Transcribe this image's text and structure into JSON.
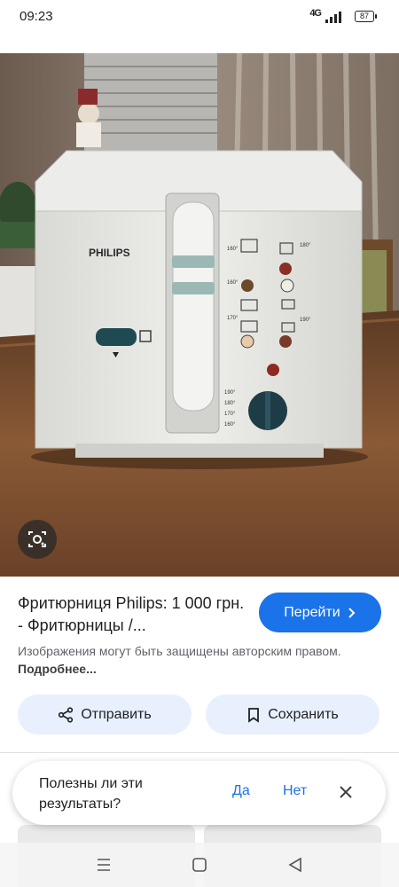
{
  "status": {
    "time": "09:23",
    "network": "4G",
    "battery": "87"
  },
  "result": {
    "title": "Фритюрниця Philips: 1 000 грн. - Фритюрницы /...",
    "goto_label": "Перейти",
    "notice": "Изображения могут быть защищены авторским правом.",
    "more_label": "Подробнее..."
  },
  "actions": {
    "share_label": "Отправить",
    "save_label": "Сохранить"
  },
  "feedback": {
    "question": "Полезны ли эти результаты?",
    "yes_label": "Да",
    "no_label": "Нет"
  },
  "image": {
    "brand_text": "PHILIPS",
    "temps_left": [
      "190°",
      "180°",
      "170°",
      "160°"
    ],
    "panel_temps": [
      "160°",
      "180°",
      "160°",
      "170°",
      "190°"
    ]
  },
  "icons": [
    "camera-lens-icon",
    "share-icon",
    "bookmark-icon",
    "close-icon",
    "chevron-right-icon",
    "menu-nav-icon",
    "home-nav-icon",
    "back-nav-icon"
  ],
  "colors": {
    "accent": "#1a73e8",
    "chip_bg": "#e8f0fe",
    "secondary_text": "#5f6368"
  }
}
